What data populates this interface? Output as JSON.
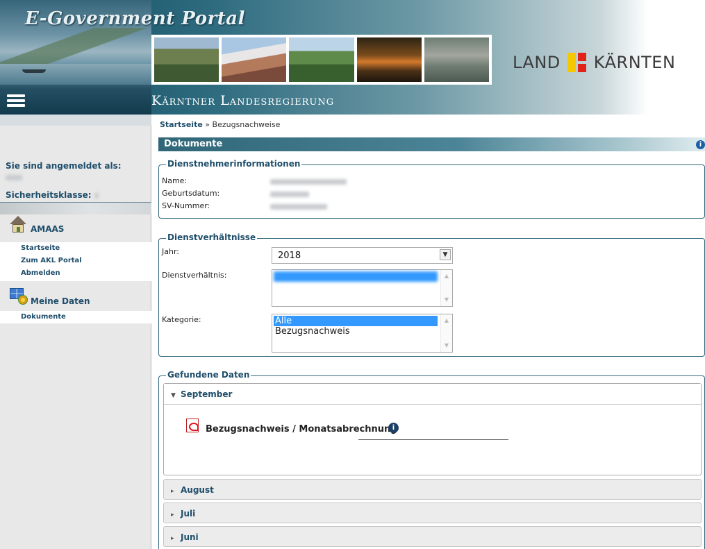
{
  "header": {
    "portal_title": "E-Government Portal",
    "gov_title": "Kärntner Landesregierung",
    "logo_left": "LAND",
    "logo_right": "KÄRNTEN"
  },
  "sidebar": {
    "login_label": "Sie sind angemeldet als:",
    "security_label": "Sicherheitsklasse:",
    "groups": [
      {
        "label": "AMAAS",
        "icon": "home-icon",
        "items": [
          "Startseite",
          "Zum AKL Portal",
          "Abmelden"
        ]
      },
      {
        "label": "Meine Daten",
        "icon": "data-icon",
        "items": [
          "Dokumente"
        ]
      }
    ]
  },
  "breadcrumb": {
    "home": "Startseite",
    "separator": " » ",
    "current": "Bezugsnachweise"
  },
  "main": {
    "section_title": "Dokumente",
    "employee_info": {
      "legend": "Dienstnehmerinformationen",
      "fields": [
        {
          "label": "Name:"
        },
        {
          "label": "Geburtsdatum:"
        },
        {
          "label": "SV-Nummer:"
        }
      ]
    },
    "employment": {
      "legend": "Dienstverhältnisse",
      "year_label": "Jahr:",
      "year_value": "2018",
      "relation_label": "Dienstverhältnis:",
      "category_label": "Kategorie:",
      "category_options": [
        "Alle",
        "Bezugsnachweis"
      ],
      "category_selected": "Alle"
    },
    "results": {
      "legend": "Gefundene Daten",
      "months": [
        {
          "label": "September",
          "expanded": true,
          "documents": [
            "Bezugsnachweis / Monatsabrechnung"
          ]
        },
        {
          "label": "August",
          "expanded": false
        },
        {
          "label": "Juli",
          "expanded": false
        },
        {
          "label": "Juni",
          "expanded": false
        }
      ]
    }
  },
  "colors": {
    "accent": "#1f4e6b",
    "selection": "#3399ff",
    "logo_yellow": "#f5c800",
    "logo_red": "#e2231a"
  }
}
